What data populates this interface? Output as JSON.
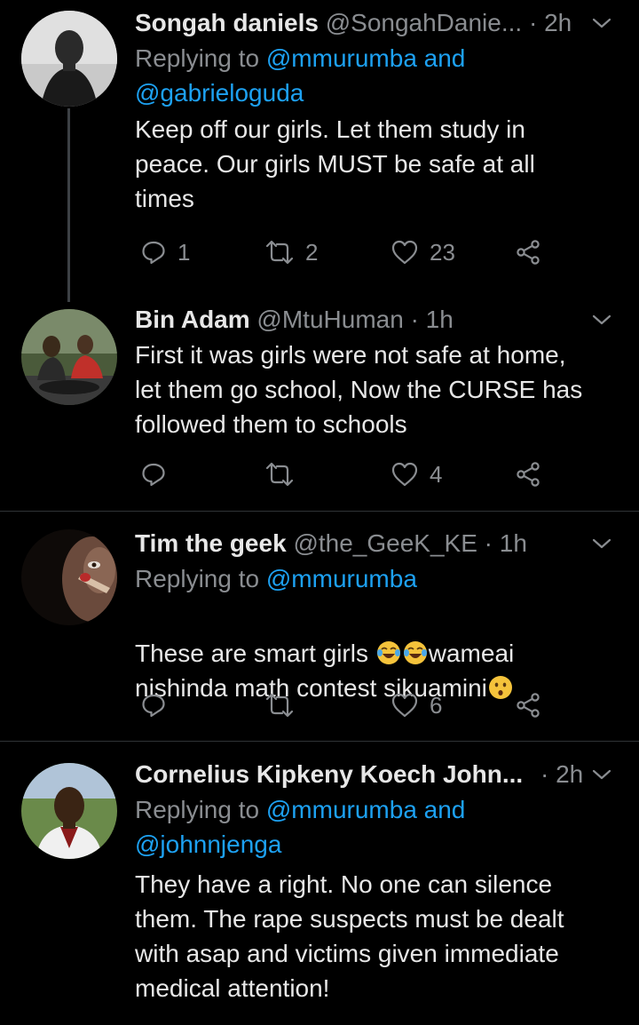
{
  "tweets": [
    {
      "name": "Songah daniels",
      "handle": "@SongahDanie...",
      "time": "· 2h",
      "replying_prefix": "Replying to ",
      "replying_line1": "@mmurumba and",
      "replying_line2": "@gabrieloguda",
      "text": "Keep off our girls.  Let them study in\npeace.  Our girls MUST be safe at all\ntimes",
      "reply_count": "1",
      "retweet_count": "2",
      "like_count": "23"
    },
    {
      "name": "Bin Adam",
      "handle": "@MtuHuman",
      "time": "· 1h",
      "text": "First it was girls were not safe at home,\nlet them go school, Now the CURSE has\nfollowed them to schools",
      "reply_count": "",
      "retweet_count": "",
      "like_count": "4"
    },
    {
      "name": "Tim the geek",
      "handle": "@the_GeeK_KE",
      "time": "· 1h",
      "replying_prefix": "Replying to ",
      "replying_line1": "@mmurumba",
      "text_part1": "These are smart girls ",
      "text_part2": "wameai",
      "text_part3": "nishinda math contest sikuamini",
      "emoji_1": "face-with-tears-of-joy-emoji",
      "emoji_2": "face-with-tears-of-joy-emoji",
      "emoji_3": "hushed-face-emoji",
      "reply_count": "",
      "retweet_count": "",
      "like_count": "6"
    },
    {
      "name": "Cornelius Kipkeny Koech John...",
      "handle": "",
      "time": "· 2h",
      "replying_prefix": "Replying to ",
      "replying_line1": "@mmurumba and",
      "replying_line2": "@johnnjenga",
      "text": "They have a right. No one can silence\nthem. The rape suspects must be dealt\nwith asap and victims given immediate\nmedical attention!"
    }
  ],
  "colors": {
    "background": "#000000",
    "mention": "#1da1f2",
    "secondary_text": "#8a8d91",
    "primary_text": "#e7e7e7"
  },
  "icons": {
    "reply": "reply-icon",
    "retweet": "retweet-icon",
    "like": "heart-icon",
    "share": "share-icon",
    "menu": "chevron-down-icon"
  }
}
